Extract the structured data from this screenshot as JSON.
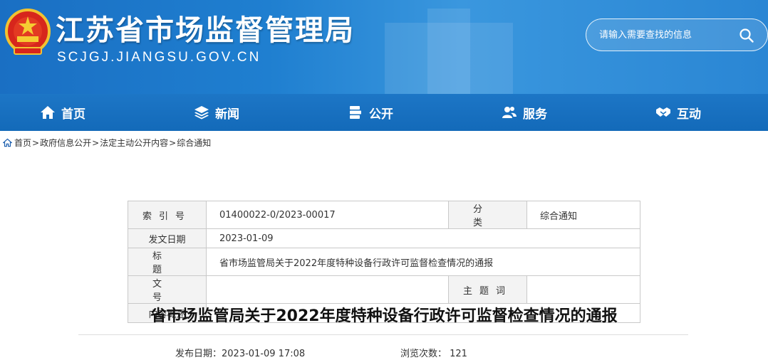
{
  "header": {
    "site_title": "江苏省市场监督管理局",
    "site_domain": "SCJGJ.JIANGSU.GOV.CN",
    "search_placeholder": "请输入需要查找的信息",
    "colors": {
      "banner": "#1f7fd0",
      "nav": "#1670c0"
    }
  },
  "nav": {
    "items": [
      {
        "label": "首页",
        "icon": "home-icon"
      },
      {
        "label": "新闻",
        "icon": "layers-icon"
      },
      {
        "label": "公开",
        "icon": "stack-icon"
      },
      {
        "label": "服务",
        "icon": "users-icon"
      },
      {
        "label": "互动",
        "icon": "handshake-icon"
      }
    ]
  },
  "breadcrumb": {
    "items": [
      "首页",
      "政府信息公开",
      "法定主动公开内容",
      "综合通知"
    ],
    "separator": ">"
  },
  "info": {
    "index_label": "索引号",
    "index_value": "01400022-0/2023-00017",
    "category_label": "分类",
    "category_value": "综合通知",
    "date_label": "发文日期",
    "date_value": "2023-01-09",
    "title_label": "标题",
    "title_value": "省市场监管局关于2022年度特种设备行政许可监督检查情况的通报",
    "doc_no_label": "文号",
    "doc_no_value": "",
    "subject_label": "主题词",
    "subject_value": "",
    "summary_label": "内容概述",
    "summary_value": ""
  },
  "article": {
    "title": "省市场监管局关于2022年度特种设备行政许可监督检查情况的通报",
    "publish_label": "发布日期：2023-01-09 17:08",
    "views_label": "浏览次数： 121"
  }
}
